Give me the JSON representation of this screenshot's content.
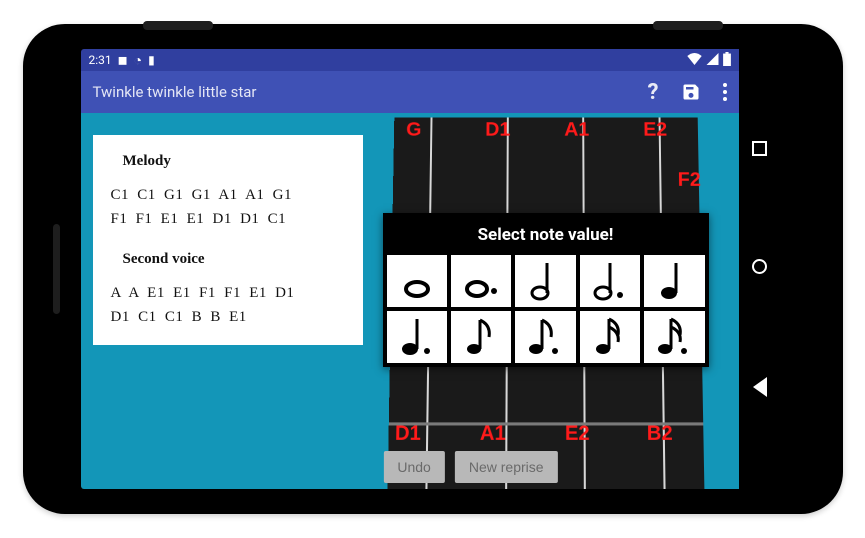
{
  "status": {
    "time": "2:31"
  },
  "appbar": {
    "title": "Twinkle twinkle little star"
  },
  "melody": {
    "heading1": "Melody",
    "line1": "C1  C1  G1  G1  A1  A1  G1",
    "line2": "F1  F1  E1  E1  D1  D1  C1",
    "heading2": "Second voice",
    "line3": "A  A  E1  E1  F1  F1  E1  D1",
    "line4": "D1  C1  C1  B  B  E1"
  },
  "fret_labels": {
    "top": [
      "G",
      "D1",
      "A1",
      "E2"
    ],
    "side": "F2",
    "bottom": [
      "D1",
      "A1",
      "E2",
      "B2"
    ]
  },
  "dialog": {
    "title": "Select note value!",
    "notes": [
      "whole",
      "dotted-whole",
      "half",
      "dotted-half",
      "quarter",
      "dotted-quarter",
      "eighth",
      "eighth-flag",
      "sixteenth",
      "dotted-sixteenth"
    ]
  },
  "buttons": {
    "undo": "Undo",
    "new_reprise": "New reprise"
  }
}
